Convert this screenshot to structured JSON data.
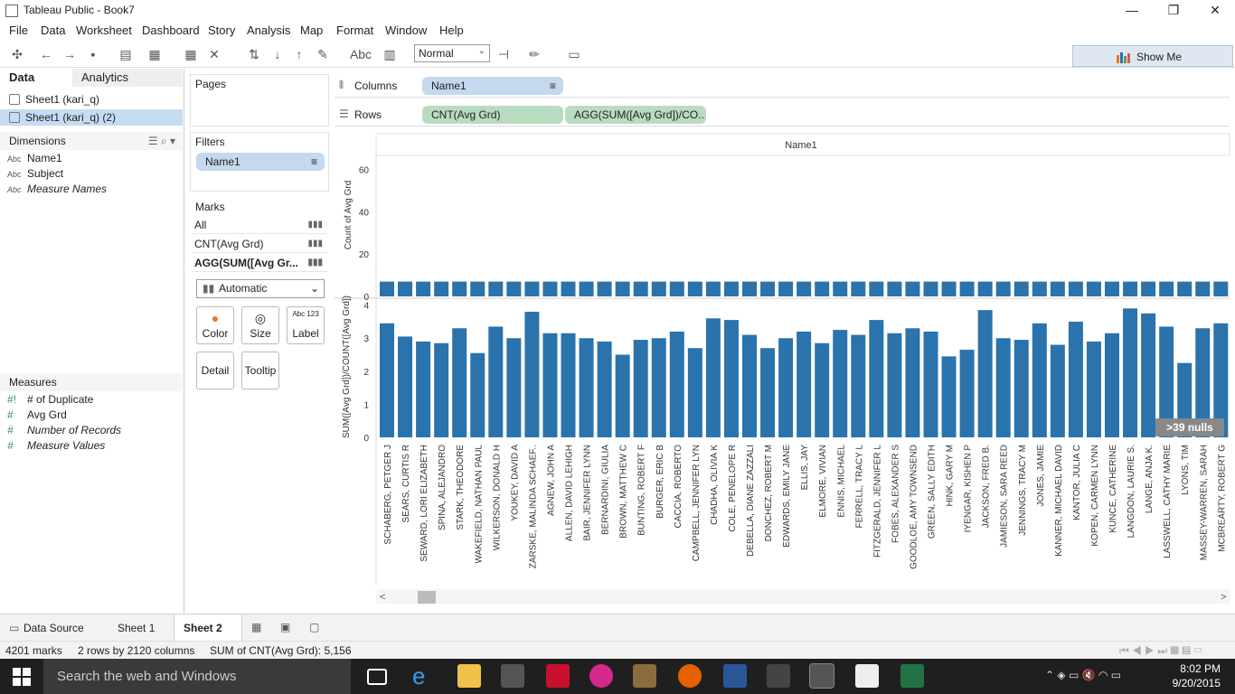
{
  "window": {
    "title": "Tableau Public - Book7",
    "minimize": "—",
    "restore": "❐",
    "close": "✕"
  },
  "menu": [
    "File",
    "Data",
    "Worksheet",
    "Dashboard",
    "Story",
    "Analysis",
    "Map",
    "Format",
    "Window",
    "Help"
  ],
  "toolbar": {
    "fit_value": "Normal",
    "show_me": "Show Me"
  },
  "left_pane": {
    "tabs": [
      "Data",
      "Analytics"
    ],
    "sources": [
      "Sheet1 (kari_q)",
      "Sheet1 (kari_q) (2)"
    ],
    "dimensions_header": "Dimensions",
    "dimensions": [
      {
        "type": "Abc",
        "name": "Name1",
        "italic": false
      },
      {
        "type": "Abc",
        "name": "Subject",
        "italic": false
      },
      {
        "type": "Abc",
        "name": "Measure Names",
        "italic": true
      }
    ],
    "measures_header": "Measures",
    "measures": [
      {
        "type": "#!",
        "name": "# of Duplicate",
        "italic": false
      },
      {
        "type": "#",
        "name": "Avg Grd",
        "italic": false
      },
      {
        "type": "#",
        "name": "Number of Records",
        "italic": true
      },
      {
        "type": "#",
        "name": "Measure Values",
        "italic": true
      }
    ]
  },
  "cards": {
    "pages": "Pages",
    "filters": "Filters",
    "filter_pills": [
      "Name1"
    ],
    "marks": "Marks",
    "mark_rows": [
      "All",
      "CNT(Avg Grd)",
      "AGG(SUM([Avg Gr..."
    ],
    "mark_type": "Automatic",
    "mark_buttons": [
      "Color",
      "Size",
      "Label",
      "Detail",
      "Tooltip"
    ],
    "label_icon": "Abc 123"
  },
  "shelves": {
    "columns_label": "Columns",
    "rows_label": "Rows",
    "columns_pills": [
      "Name1"
    ],
    "rows_pills": [
      "CNT(Avg Grd)",
      "AGG(SUM([Avg Grd])/CO.."
    ]
  },
  "chart_data": {
    "type": "bar",
    "header": "Name1",
    "nulls_badge": ">39 nulls",
    "categories": [
      "SCHABERG, PETGER J",
      "SEARS, CURTIS R",
      "SEWARD, LORI ELIZABETH",
      "SPINA, ALEJANDRO",
      "STARK, THEODORE",
      "WAKEFIELD, NATHAN PAUL",
      "WILKERSON, DONALD H",
      "YOUKEY, DAVID A",
      "ZARSKE, MALINDA SCHAEF..",
      "AGNEW, JOHN A",
      "ALLEN, DAVID LEHIGH",
      "BAIR, JENNIFER LYNN",
      "BERNARDINI, GIULIA",
      "BROWN, MATTHEW C",
      "BUNTING, ROBERT F",
      "BURGER, ERIC B",
      "CACCIA, ROBERTO",
      "CAMPBELL, JENNIFER LYN",
      "CHADHA, OLIVIA K",
      "COLE, PENELOPE R",
      "DEBELLA, DIANE ZAZZALI",
      "DONCHEZ, ROBERT M",
      "EDWARDS, EMILY JANE",
      "ELLIS, JAY",
      "ELMORE, VIVIAN",
      "ENNIS, MICHAEL",
      "FERRELL, TRACY L",
      "FITZGERALD, JENNIFER L",
      "FOBES, ALEXANDER S",
      "GOODLOE, AMY TOWNSEND",
      "GREEN, SALLY EDITH",
      "HINK, GARY M",
      "IYENGAR, KISHEN P",
      "JACKSON, FRED B.",
      "JAMIESON, SARA REED",
      "JENNINGS, TRACY M",
      "JONES, JAMIE",
      "KANNER, MICHAEL DAVID",
      "KANTOR, JULIA C",
      "KOPEN, CARMEN LYNN",
      "KUNCE, CATHERINE",
      "LANGDON, LAURIE S.",
      "LANGE, ANJA K.",
      "LASSWELL, CATHY MARIE",
      "LYONS, TIM",
      "MASSEY-WARREN, SARAH",
      "MCBREARTY, ROBERT G"
    ],
    "top_pane": {
      "ylabel": "Count of Avg Grd",
      "ylim": [
        0,
        65
      ],
      "yticks": [
        0,
        20,
        40,
        60
      ],
      "values": [
        7,
        7,
        7,
        7,
        7,
        7,
        7,
        7,
        7,
        7,
        7,
        7,
        7,
        7,
        7,
        7,
        7,
        7,
        7,
        7,
        7,
        7,
        7,
        7,
        7,
        7,
        7,
        7,
        7,
        7,
        7,
        7,
        7,
        7,
        7,
        7,
        7,
        7,
        7,
        7,
        7,
        7,
        7,
        7,
        7,
        7,
        7
      ]
    },
    "bottom_pane": {
      "ylabel": "SUM([Avg Grd])/COUNT([Avg Grd])",
      "ylim": [
        0,
        4.1
      ],
      "yticks": [
        0,
        1,
        2,
        3,
        4
      ],
      "values": [
        3.45,
        3.05,
        2.9,
        2.85,
        3.3,
        2.55,
        3.35,
        3.0,
        3.8,
        3.15,
        3.15,
        3.0,
        2.9,
        2.5,
        2.95,
        3.0,
        3.2,
        2.7,
        3.6,
        3.55,
        3.1,
        2.7,
        3.0,
        3.2,
        2.85,
        3.25,
        3.1,
        3.55,
        3.15,
        3.3,
        3.2,
        2.45,
        2.65,
        3.85,
        3.0,
        2.95,
        3.45,
        2.8,
        3.5,
        2.9,
        3.15,
        3.9,
        3.75,
        3.35,
        2.25,
        3.3,
        3.45
      ]
    },
    "bar_color": "#2a73ad"
  },
  "sheet_tabs": {
    "data_source": "Data Source",
    "tabs": [
      "Sheet 1",
      "Sheet 2"
    ],
    "active": "Sheet 2"
  },
  "status": {
    "marks": "4201 marks",
    "dims": "2 rows by 2120 columns",
    "sum": "SUM of CNT(Avg Grd): 5,156"
  },
  "taskbar": {
    "search": "Search the web and Windows",
    "time": "8:02 PM",
    "date": "9/20/2015"
  }
}
